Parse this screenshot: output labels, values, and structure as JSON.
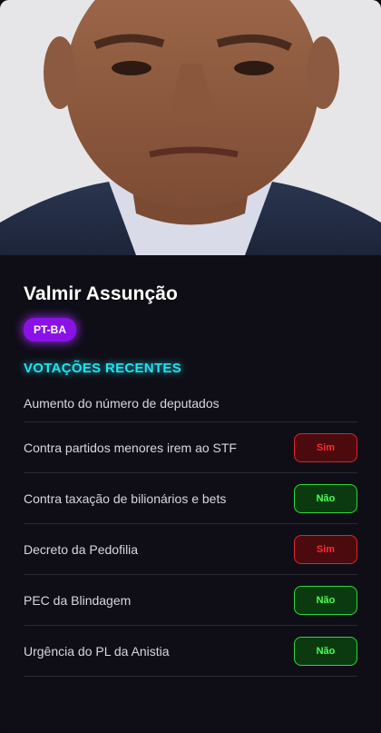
{
  "profile": {
    "name": "Valmir Assunção",
    "party_badge": "PT-BA"
  },
  "section_title": "VOTAÇÕES RECENTES",
  "votes": [
    {
      "label": "Aumento do número de deputados",
      "vote": ""
    },
    {
      "label": "Contra partidos menores irem ao STF",
      "vote": "Sim"
    },
    {
      "label": "Contra taxação de bilionários e bets",
      "vote": "Não"
    },
    {
      "label": "Decreto da Pedofilia",
      "vote": "Sim"
    },
    {
      "label": "PEC da Blindagem",
      "vote": "Não"
    },
    {
      "label": "Urgência do PL da Anistia",
      "vote": "Não"
    }
  ],
  "colors": {
    "accent_cyan": "#21e3f0",
    "badge_purple": "#8a12e6",
    "vote_yes_red": "#ff2a33",
    "vote_no_green": "#4cff55"
  }
}
